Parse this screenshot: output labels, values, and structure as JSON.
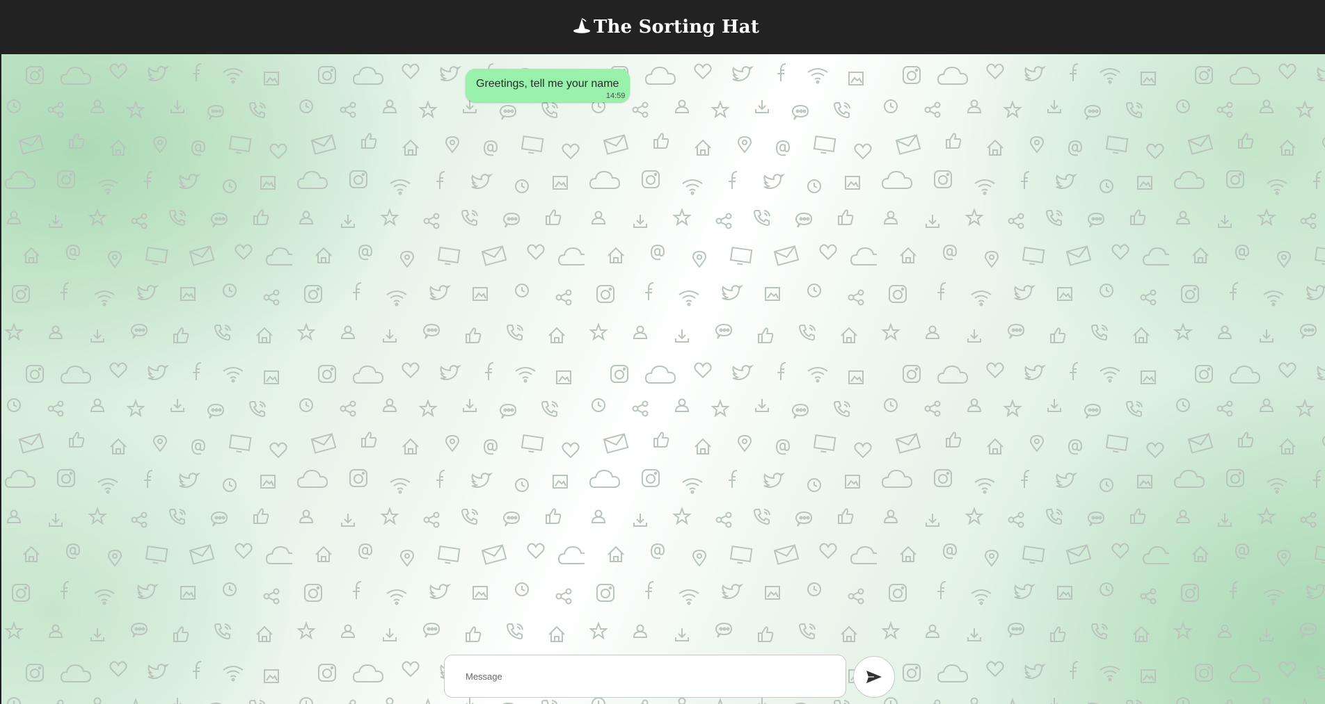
{
  "header": {
    "title": "The Sorting Hat",
    "icon": "wizard-hat-icon"
  },
  "chat": {
    "messages": [
      {
        "text": "Greetings, tell me your name",
        "time": "14:59",
        "sender": "bot"
      }
    ],
    "background_icons": [
      "instagram-icon",
      "cloud-icon",
      "heart-icon",
      "twitter-icon",
      "facebook-icon",
      "wifi-icon",
      "envelope-icon",
      "thumbs-up-icon",
      "home-icon",
      "star-icon",
      "download-icon",
      "clock-icon",
      "image-icon",
      "share-icon",
      "user-icon",
      "map-pin-icon",
      "at-sign-icon",
      "phone-icon",
      "chat-bubble-icon",
      "monitor-icon"
    ]
  },
  "composer": {
    "placeholder": "Message",
    "value": "",
    "send_icon": "send-arrow-icon"
  },
  "colors": {
    "header_bg": "#222222",
    "bubble_bg": "#98f2ac",
    "background_green": "#b9e0c0"
  }
}
